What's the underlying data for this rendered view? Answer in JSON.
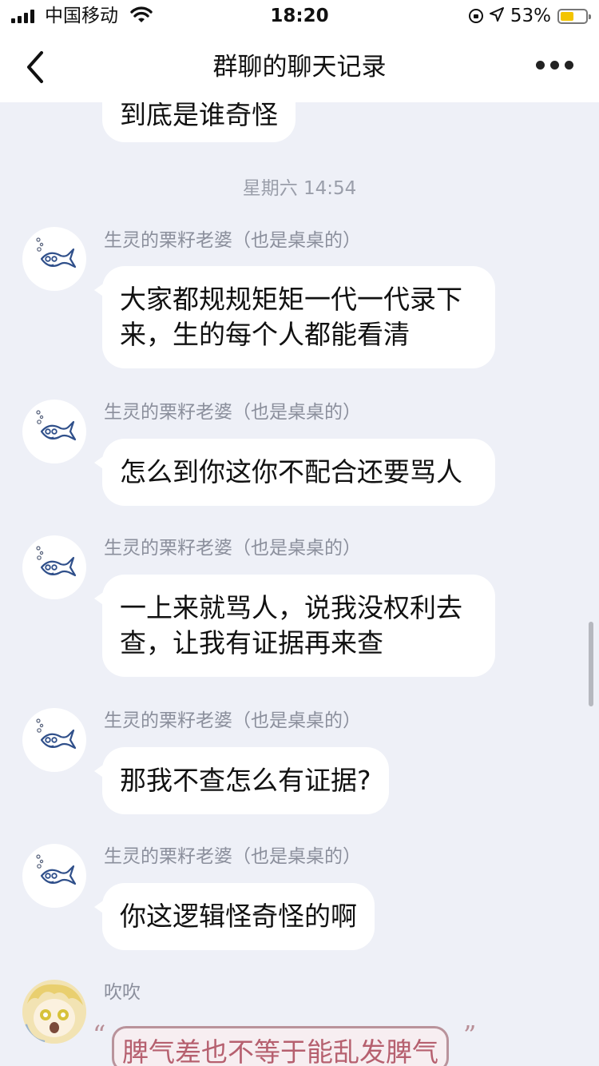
{
  "status_bar": {
    "carrier": "中国移动",
    "time": "18:20",
    "battery_percent": "53%",
    "battery_level": 0.53,
    "icons": [
      "signal-icon",
      "wifi-icon",
      "rotation-lock-icon",
      "location-icon",
      "battery-icon"
    ]
  },
  "nav": {
    "title": "群聊的聊天记录",
    "back_icon": "chevron-left-icon",
    "more_icon": "more-dots-icon"
  },
  "chat": {
    "partial_top_message": "到底是谁奇怪",
    "time_divider": "星期六 14:54",
    "messages": [
      {
        "sender": "生灵的栗籽老婆（也是桌桌的）",
        "lines": [
          "大家都规规矩矩一代一代录下",
          "来，生的每个人都能看清"
        ]
      },
      {
        "sender": "生灵的栗籽老婆（也是桌桌的）",
        "lines": [
          "怎么到你这你不配合还要骂人"
        ]
      },
      {
        "sender": "生灵的栗籽老婆（也是桌桌的）",
        "lines": [
          "一上来就骂人，说我没权利去",
          "查，让我有证据再来查"
        ]
      },
      {
        "sender": "生灵的栗籽老婆（也是桌桌的）",
        "lines": [
          "那我不查怎么有证据?"
        ]
      },
      {
        "sender": "生灵的栗籽老婆（也是桌桌的）",
        "lines": [
          "你这逻辑怪奇怪的啊"
        ]
      }
    ],
    "last_message": {
      "sender": "吹吹",
      "text": "脾气差也不等于能乱发脾气",
      "open_quote": "“",
      "close_quote": "”"
    }
  },
  "colors": {
    "background": "#eef0f7",
    "bubble": "#ffffff",
    "sender_text": "#8b8f9c",
    "special_bubble_text": "#b6606f"
  }
}
